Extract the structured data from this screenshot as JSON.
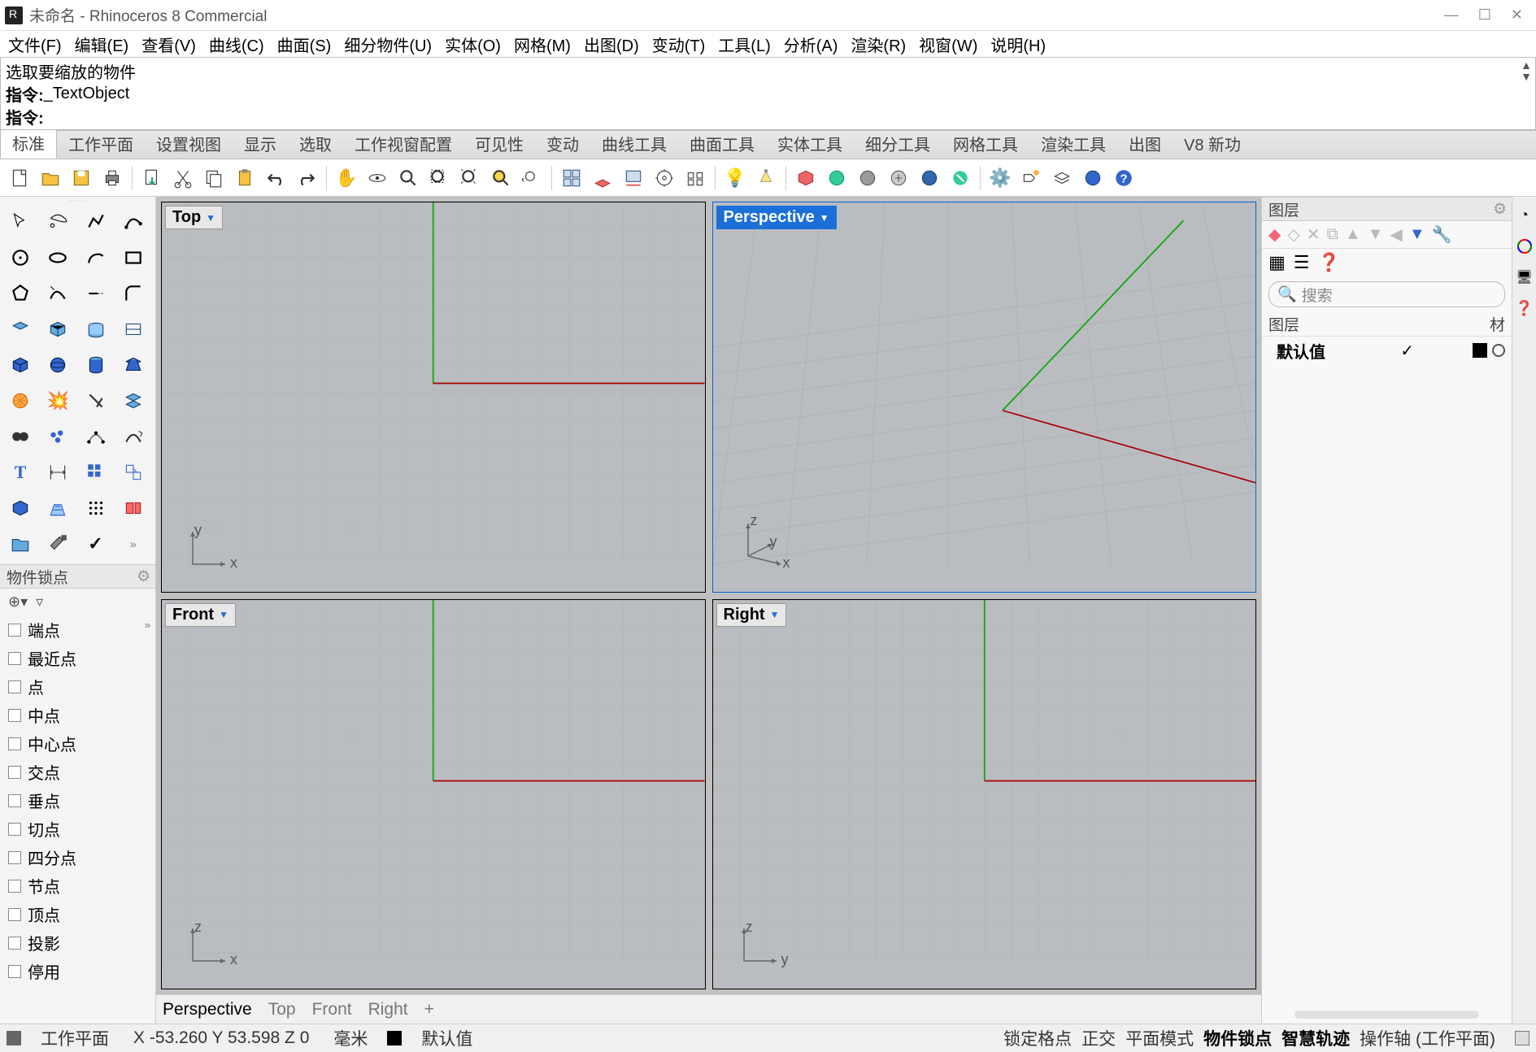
{
  "title": "未命名 - Rhinoceros 8 Commercial",
  "menus": [
    "文件(F)",
    "编辑(E)",
    "查看(V)",
    "曲线(C)",
    "曲面(S)",
    "细分物件(U)",
    "实体(O)",
    "网格(M)",
    "出图(D)",
    "变动(T)",
    "工具(L)",
    "分析(A)",
    "渲染(R)",
    "视窗(W)",
    "说明(H)"
  ],
  "cmd_history1": "选取要缩放的物件",
  "cmd_history2_label": "指令:",
  "cmd_history2_value": " _TextObject",
  "cmd_prompt": "指令:",
  "tabs": [
    "标准",
    "工作平面",
    "设置视图",
    "显示",
    "选取",
    "工作视窗配置",
    "可见性",
    "变动",
    "曲线工具",
    "曲面工具",
    "实体工具",
    "细分工具",
    "网格工具",
    "渲染工具",
    "出图",
    "V8 新功"
  ],
  "active_tab": 0,
  "viewports": {
    "tl": "Top",
    "tr": "Perspective",
    "bl": "Front",
    "br": "Right"
  },
  "axes": {
    "tl_v": "y",
    "tl_h": "x",
    "tr_v": "z",
    "tr_m": "y",
    "tr_h": "x",
    "bl_v": "z",
    "bl_h": "x",
    "br_v": "z",
    "br_h": "y"
  },
  "viewtabs": [
    "Perspective",
    "Top",
    "Front",
    "Right",
    "+"
  ],
  "active_viewtab": 0,
  "osnap_title": "物件锁点",
  "osnaps": [
    "端点",
    "最近点",
    "点",
    "中点",
    "中心点",
    "交点",
    "垂点",
    "切点",
    "四分点",
    "节点",
    "顶点",
    "投影",
    "停用"
  ],
  "layers_title": "图层",
  "search_placeholder": "搜索",
  "layer_col": "图层",
  "mat_col": "材",
  "default_layer": "默认值",
  "status": {
    "cplane": "工作平面",
    "coords": "X -53.260 Y 53.598 Z 0",
    "units": "毫米",
    "layer": "默认值",
    "items": [
      "锁定格点",
      "正交",
      "平面模式",
      "物件锁点",
      "智慧轨迹",
      "操作轴 (工作平面)"
    ],
    "bold": [
      3,
      4
    ]
  }
}
